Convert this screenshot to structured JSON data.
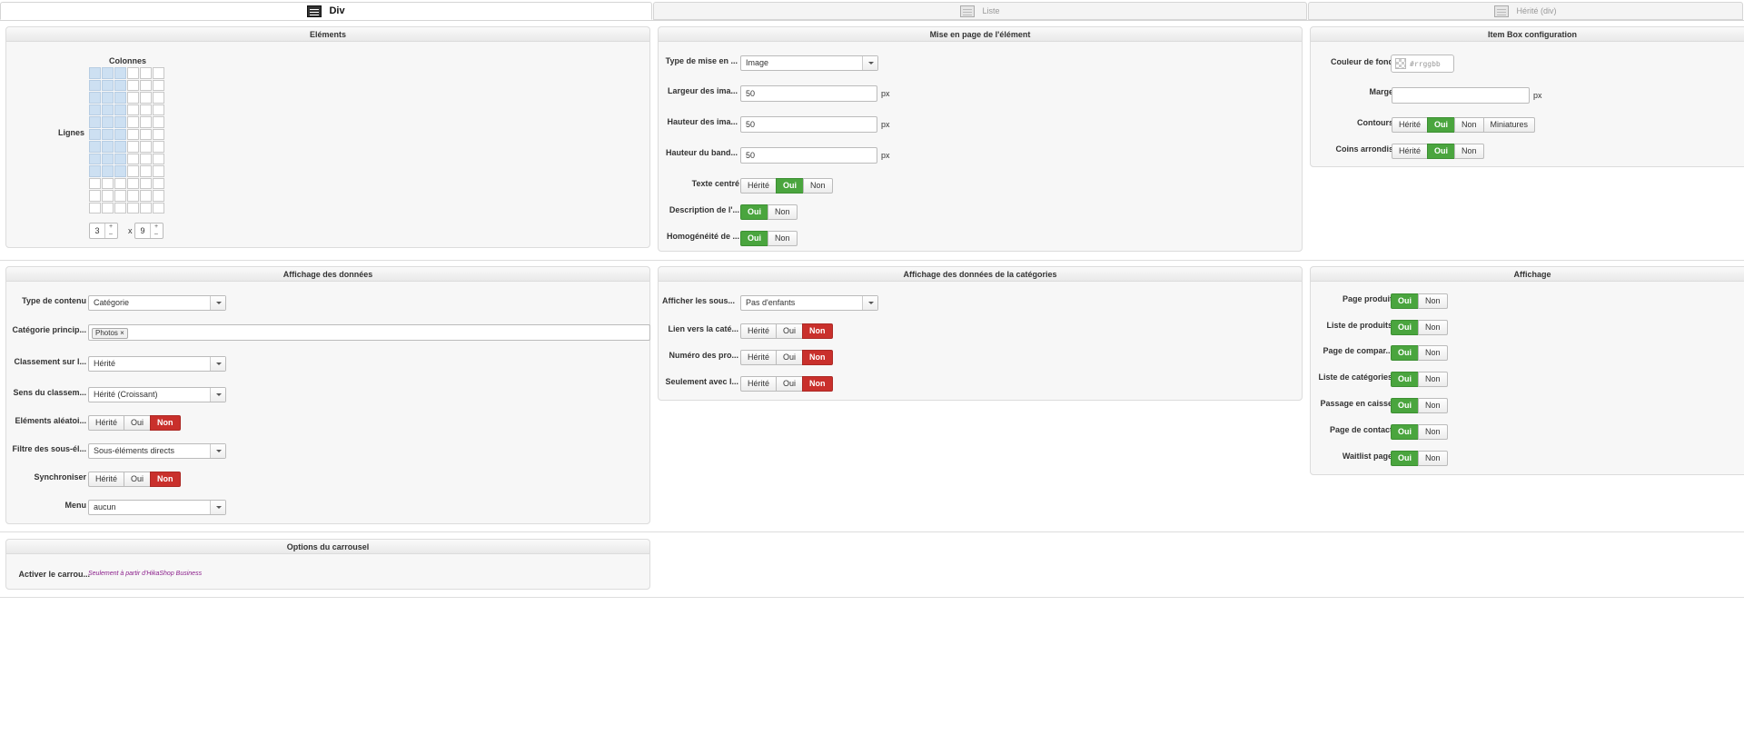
{
  "tabs": [
    {
      "label": "Div",
      "icon": "div-layout-icon",
      "active": true
    },
    {
      "label": "Liste",
      "icon": "list-layout-icon",
      "active": false
    },
    {
      "label": "Hérité (div)",
      "icon": "inherit-layout-icon",
      "active": false
    }
  ],
  "elements": {
    "title": "Eléments",
    "columns_label": "Colonnes",
    "rows_label": "Lignes",
    "columns_value": "3",
    "times": "x",
    "rows_value": "9",
    "spin_up": "+",
    "spin_down": "–"
  },
  "layout": {
    "title": "Mise en page de l'élément",
    "type_label": "Type de mise en ...",
    "type_value": "Image",
    "width_label": "Largeur des ima...",
    "width_value": "50",
    "height_label": "Hauteur des ima...",
    "height_value": "50",
    "band_label": "Hauteur du band...",
    "band_value": "50",
    "unit": "px",
    "centered_label": "Texte centré",
    "centered_options": [
      "Hérité",
      "Oui",
      "Non"
    ],
    "centered_selected": "Oui",
    "desc_label": "Description de l'...",
    "desc_options": [
      "Oui",
      "Non"
    ],
    "desc_selected": "Oui",
    "homog_label": "Homogénéité de ...",
    "homog_options": [
      "Oui",
      "Non"
    ],
    "homog_selected": "Oui"
  },
  "box": {
    "title": "Item Box configuration",
    "bg_label": "Couleur de fond",
    "bg_placeholder": "#rrggbb",
    "margin_label": "Marge",
    "margin_value": "",
    "unit": "px",
    "border_label": "Contours",
    "border_options": [
      "Hérité",
      "Oui",
      "Non",
      "Miniatures"
    ],
    "border_selected": "Oui",
    "round_label": "Coins arrondis",
    "round_options": [
      "Hérité",
      "Oui",
      "Non"
    ],
    "round_selected": "Oui"
  },
  "data_display": {
    "title": "Affichage des données",
    "content_type_label": "Type de contenu",
    "content_type_value": "Catégorie",
    "main_cat_label": "Catégorie princip...",
    "main_cat_tag": "Photos",
    "tag_remove": "×",
    "sort_label": "Classement sur l...",
    "sort_value": "Hérité",
    "sort_dir_label": "Sens du classem...",
    "sort_dir_value": "Hérité (Croissant)",
    "random_label": "Eléments aléatoi...",
    "random_options": [
      "Hérité",
      "Oui",
      "Non"
    ],
    "random_selected": "Non",
    "filter_label": "Filtre des sous-él...",
    "filter_value": "Sous-éléments directs",
    "sync_label": "Synchroniser",
    "sync_options": [
      "Hérité",
      "Oui",
      "Non"
    ],
    "sync_selected": "Non",
    "menu_label": "Menu",
    "menu_value": "aucun"
  },
  "cat_display": {
    "title": "Affichage des données de la catégories",
    "sub_label": "Afficher les sous...",
    "sub_value": "Pas d'enfants",
    "link_label": "Lien vers la caté...",
    "link_options": [
      "Hérité",
      "Oui",
      "Non"
    ],
    "link_selected": "Non",
    "num_label": "Numéro des pro...",
    "num_options": [
      "Hérité",
      "Oui",
      "Non"
    ],
    "num_selected": "Non",
    "only_label": "Seulement avec l...",
    "only_options": [
      "Hérité",
      "Oui",
      "Non"
    ],
    "only_selected": "Non"
  },
  "display": {
    "title": "Affichage",
    "rows": [
      {
        "label": "Page produit",
        "selected": "Oui"
      },
      {
        "label": "Liste de produits",
        "selected": "Oui"
      },
      {
        "label": "Page de compar...",
        "selected": "Oui"
      },
      {
        "label": "Liste de catégories",
        "selected": "Oui"
      },
      {
        "label": "Passage en caisse",
        "selected": "Oui"
      },
      {
        "label": "Page de contact",
        "selected": "Oui"
      },
      {
        "label": "Waitlist page",
        "selected": "Oui"
      }
    ],
    "options": [
      "Oui",
      "Non"
    ]
  },
  "carousel": {
    "title": "Options du carrousel",
    "enable_label": "Activer le carrou...",
    "note": "Seulement à partir d'HikaShop Business"
  },
  "colors": {
    "green": "#4aa53e",
    "red": "#c9302c",
    "highlight": "#cde0f2"
  }
}
